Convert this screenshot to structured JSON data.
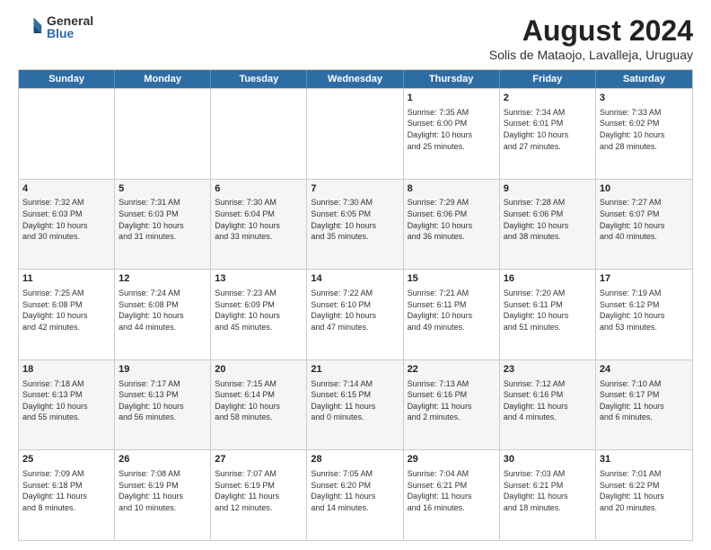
{
  "logo": {
    "general": "General",
    "blue": "Blue"
  },
  "title": "August 2024",
  "subtitle": "Solis de Mataojo, Lavalleja, Uruguay",
  "header_days": [
    "Sunday",
    "Monday",
    "Tuesday",
    "Wednesday",
    "Thursday",
    "Friday",
    "Saturday"
  ],
  "weeks": [
    [
      {
        "day": "",
        "info": ""
      },
      {
        "day": "",
        "info": ""
      },
      {
        "day": "",
        "info": ""
      },
      {
        "day": "",
        "info": ""
      },
      {
        "day": "1",
        "info": "Sunrise: 7:35 AM\nSunset: 6:00 PM\nDaylight: 10 hours\nand 25 minutes."
      },
      {
        "day": "2",
        "info": "Sunrise: 7:34 AM\nSunset: 6:01 PM\nDaylight: 10 hours\nand 27 minutes."
      },
      {
        "day": "3",
        "info": "Sunrise: 7:33 AM\nSunset: 6:02 PM\nDaylight: 10 hours\nand 28 minutes."
      }
    ],
    [
      {
        "day": "4",
        "info": "Sunrise: 7:32 AM\nSunset: 6:03 PM\nDaylight: 10 hours\nand 30 minutes."
      },
      {
        "day": "5",
        "info": "Sunrise: 7:31 AM\nSunset: 6:03 PM\nDaylight: 10 hours\nand 31 minutes."
      },
      {
        "day": "6",
        "info": "Sunrise: 7:30 AM\nSunset: 6:04 PM\nDaylight: 10 hours\nand 33 minutes."
      },
      {
        "day": "7",
        "info": "Sunrise: 7:30 AM\nSunset: 6:05 PM\nDaylight: 10 hours\nand 35 minutes."
      },
      {
        "day": "8",
        "info": "Sunrise: 7:29 AM\nSunset: 6:06 PM\nDaylight: 10 hours\nand 36 minutes."
      },
      {
        "day": "9",
        "info": "Sunrise: 7:28 AM\nSunset: 6:06 PM\nDaylight: 10 hours\nand 38 minutes."
      },
      {
        "day": "10",
        "info": "Sunrise: 7:27 AM\nSunset: 6:07 PM\nDaylight: 10 hours\nand 40 minutes."
      }
    ],
    [
      {
        "day": "11",
        "info": "Sunrise: 7:25 AM\nSunset: 6:08 PM\nDaylight: 10 hours\nand 42 minutes."
      },
      {
        "day": "12",
        "info": "Sunrise: 7:24 AM\nSunset: 6:08 PM\nDaylight: 10 hours\nand 44 minutes."
      },
      {
        "day": "13",
        "info": "Sunrise: 7:23 AM\nSunset: 6:09 PM\nDaylight: 10 hours\nand 45 minutes."
      },
      {
        "day": "14",
        "info": "Sunrise: 7:22 AM\nSunset: 6:10 PM\nDaylight: 10 hours\nand 47 minutes."
      },
      {
        "day": "15",
        "info": "Sunrise: 7:21 AM\nSunset: 6:11 PM\nDaylight: 10 hours\nand 49 minutes."
      },
      {
        "day": "16",
        "info": "Sunrise: 7:20 AM\nSunset: 6:11 PM\nDaylight: 10 hours\nand 51 minutes."
      },
      {
        "day": "17",
        "info": "Sunrise: 7:19 AM\nSunset: 6:12 PM\nDaylight: 10 hours\nand 53 minutes."
      }
    ],
    [
      {
        "day": "18",
        "info": "Sunrise: 7:18 AM\nSunset: 6:13 PM\nDaylight: 10 hours\nand 55 minutes."
      },
      {
        "day": "19",
        "info": "Sunrise: 7:17 AM\nSunset: 6:13 PM\nDaylight: 10 hours\nand 56 minutes."
      },
      {
        "day": "20",
        "info": "Sunrise: 7:15 AM\nSunset: 6:14 PM\nDaylight: 10 hours\nand 58 minutes."
      },
      {
        "day": "21",
        "info": "Sunrise: 7:14 AM\nSunset: 6:15 PM\nDaylight: 11 hours\nand 0 minutes."
      },
      {
        "day": "22",
        "info": "Sunrise: 7:13 AM\nSunset: 6:16 PM\nDaylight: 11 hours\nand 2 minutes."
      },
      {
        "day": "23",
        "info": "Sunrise: 7:12 AM\nSunset: 6:16 PM\nDaylight: 11 hours\nand 4 minutes."
      },
      {
        "day": "24",
        "info": "Sunrise: 7:10 AM\nSunset: 6:17 PM\nDaylight: 11 hours\nand 6 minutes."
      }
    ],
    [
      {
        "day": "25",
        "info": "Sunrise: 7:09 AM\nSunset: 6:18 PM\nDaylight: 11 hours\nand 8 minutes."
      },
      {
        "day": "26",
        "info": "Sunrise: 7:08 AM\nSunset: 6:19 PM\nDaylight: 11 hours\nand 10 minutes."
      },
      {
        "day": "27",
        "info": "Sunrise: 7:07 AM\nSunset: 6:19 PM\nDaylight: 11 hours\nand 12 minutes."
      },
      {
        "day": "28",
        "info": "Sunrise: 7:05 AM\nSunset: 6:20 PM\nDaylight: 11 hours\nand 14 minutes."
      },
      {
        "day": "29",
        "info": "Sunrise: 7:04 AM\nSunset: 6:21 PM\nDaylight: 11 hours\nand 16 minutes."
      },
      {
        "day": "30",
        "info": "Sunrise: 7:03 AM\nSunset: 6:21 PM\nDaylight: 11 hours\nand 18 minutes."
      },
      {
        "day": "31",
        "info": "Sunrise: 7:01 AM\nSunset: 6:22 PM\nDaylight: 11 hours\nand 20 minutes."
      }
    ]
  ]
}
